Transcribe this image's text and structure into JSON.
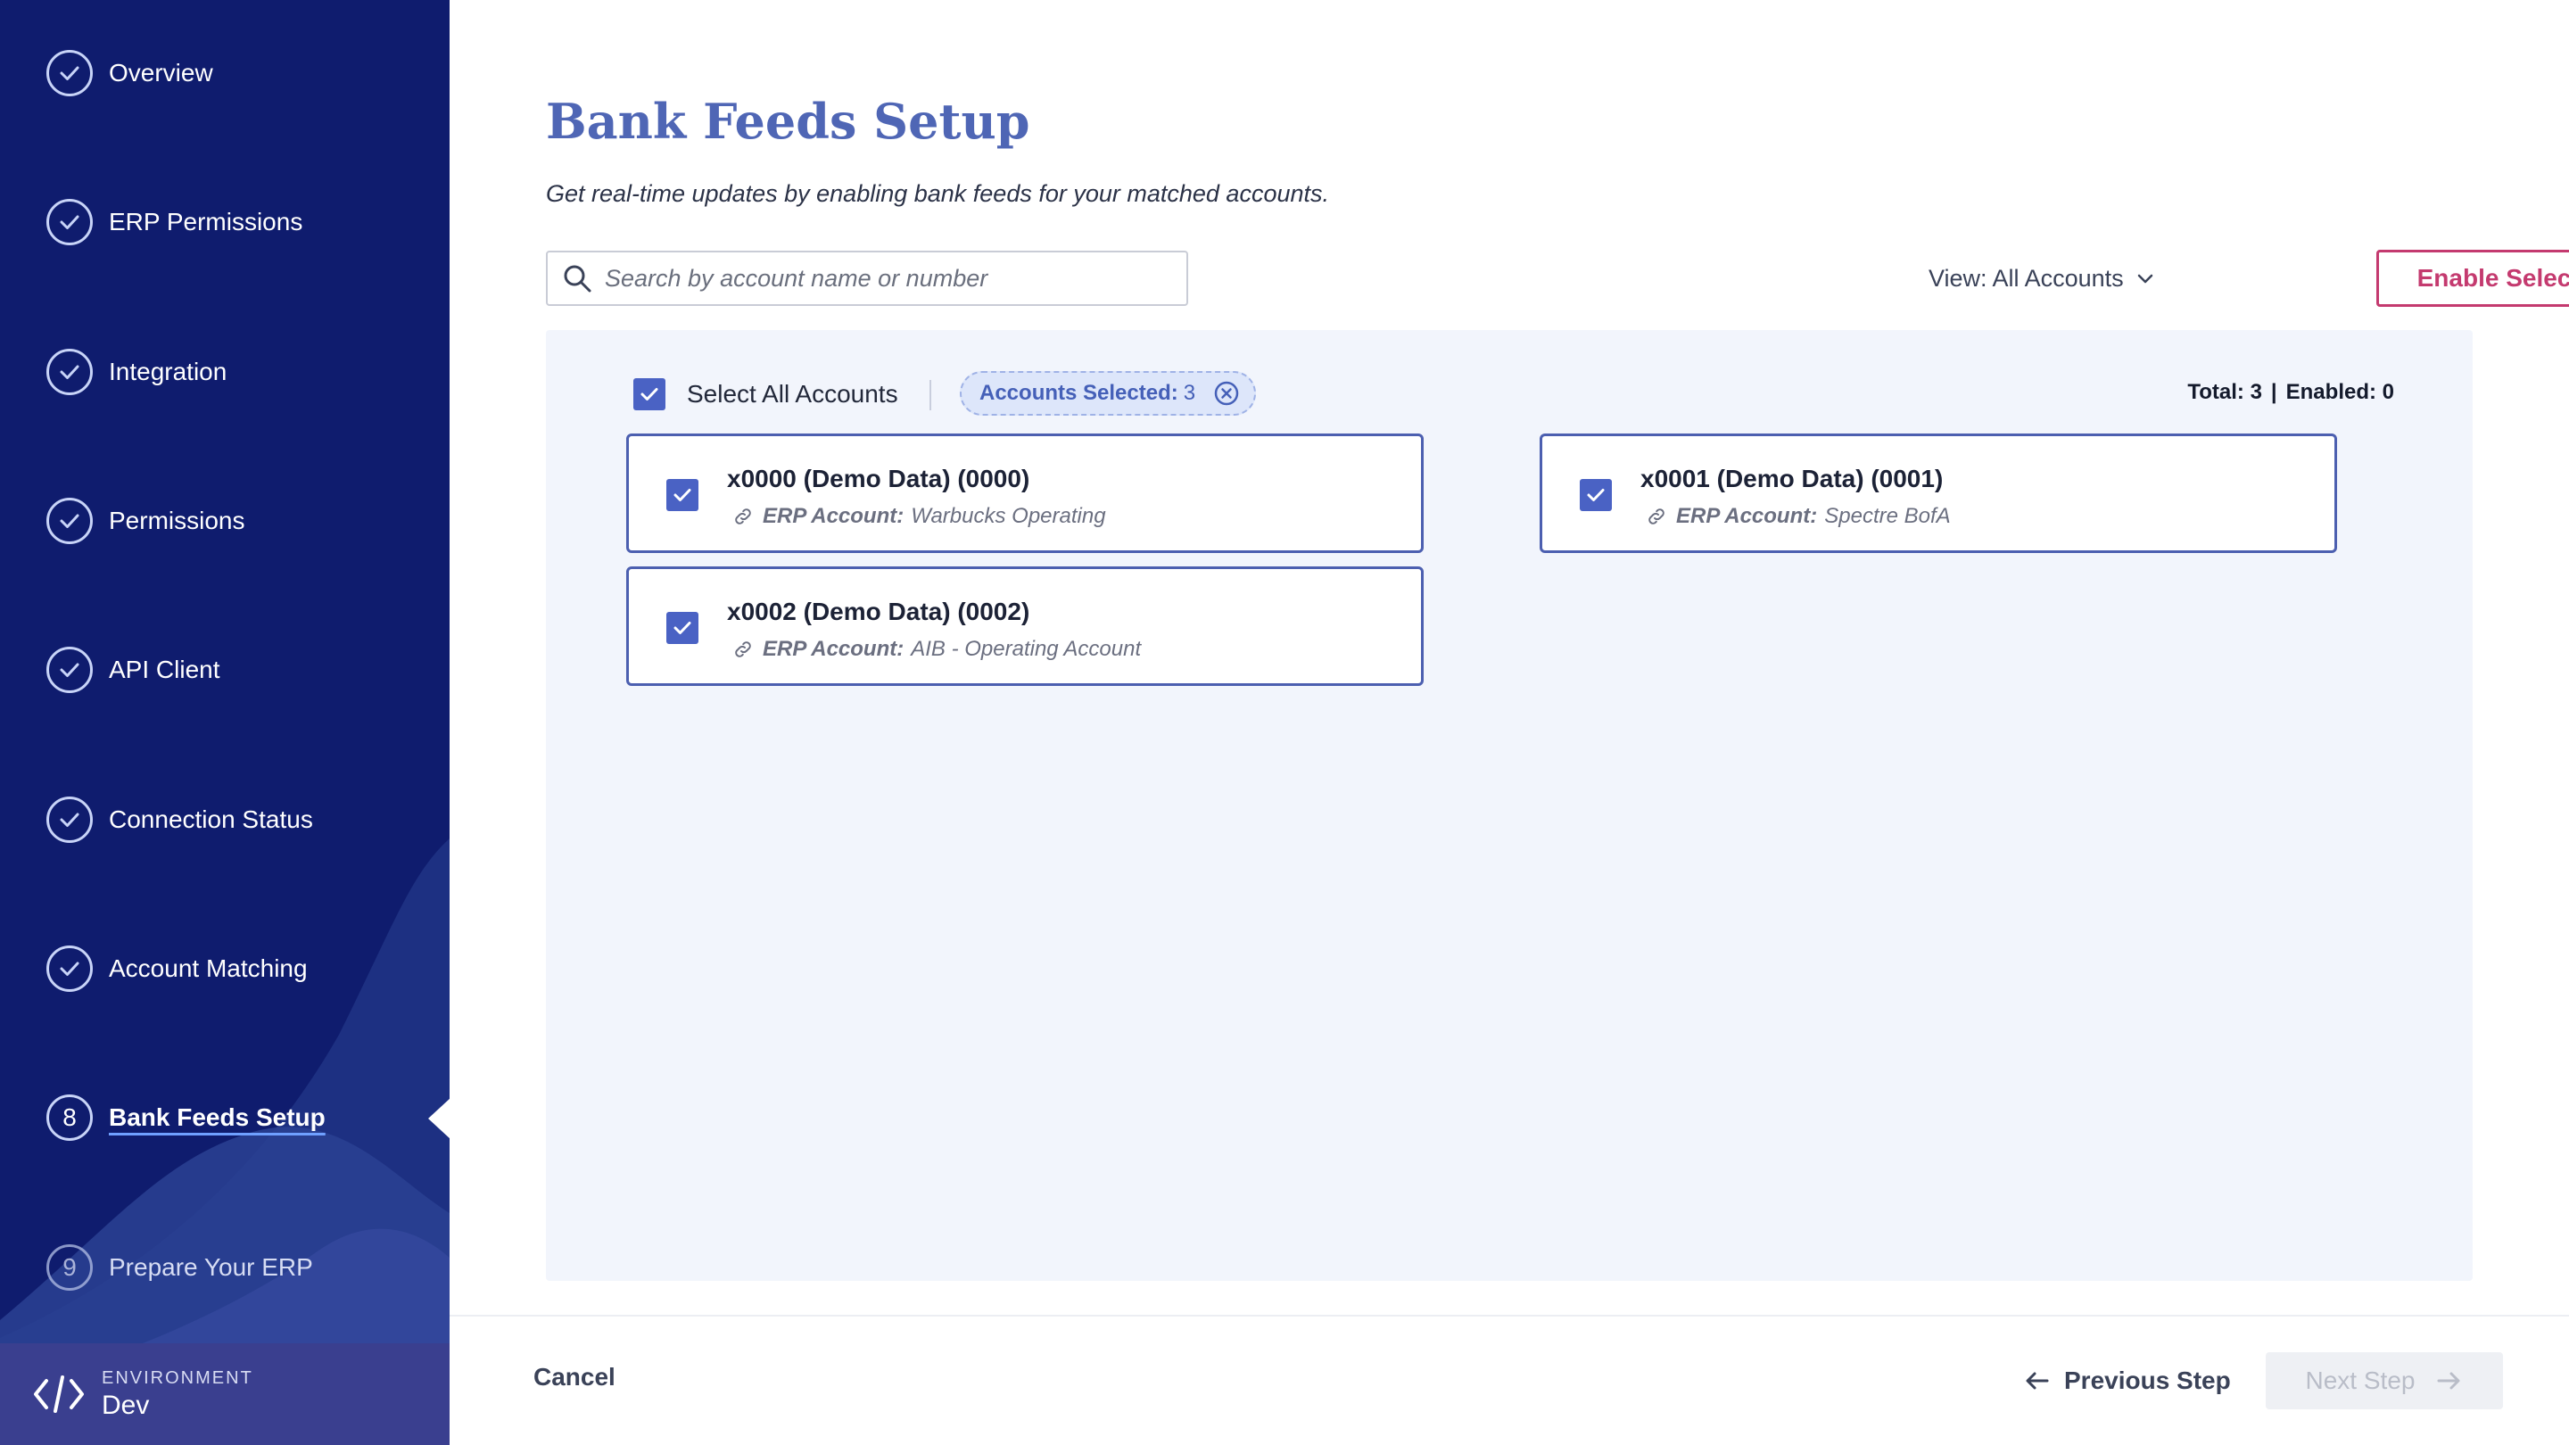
{
  "sidebar": {
    "items": [
      {
        "label": "Overview",
        "state": "done"
      },
      {
        "label": "ERP Permissions",
        "state": "done"
      },
      {
        "label": "Integration",
        "state": "done"
      },
      {
        "label": "Permissions",
        "state": "done"
      },
      {
        "label": "API Client",
        "state": "done"
      },
      {
        "label": "Connection Status",
        "state": "done"
      },
      {
        "label": "Account Matching",
        "state": "done"
      },
      {
        "label": "Bank Feeds Setup",
        "state": "active",
        "number": "8"
      },
      {
        "label": "Prepare Your ERP",
        "state": "upcoming",
        "number": "9"
      }
    ],
    "environment": {
      "caption": "ENVIRONMENT",
      "value": "Dev"
    }
  },
  "page": {
    "title": "Bank Feeds Setup",
    "subtitle": "Get real-time updates by enabling bank feeds for your matched accounts."
  },
  "toolbar": {
    "search_placeholder": "Search by account name or number",
    "view_label": "View: All Accounts",
    "enable_label": "Enable Selected"
  },
  "selection": {
    "select_all_label": "Select All Accounts",
    "chip_label": "Accounts Selected:",
    "chip_count": "3",
    "total_text": "Total: 3",
    "enabled_text": "Enabled: 0"
  },
  "accounts": [
    {
      "name": "x0000 (Demo Data) (0000)",
      "erp_key": "ERP Account:",
      "erp_value": "Warbucks Operating",
      "checked": true
    },
    {
      "name": "x0001 (Demo Data) (0001)",
      "erp_key": "ERP Account:",
      "erp_value": "Spectre BofA",
      "checked": true
    },
    {
      "name": "x0002 (Demo Data) (0002)",
      "erp_key": "ERP Account:",
      "erp_value": "AIB - Operating Account",
      "checked": true
    }
  ],
  "footer": {
    "cancel_label": "Cancel",
    "previous_label": "Previous Step",
    "next_label": "Next Step"
  },
  "colors": {
    "sidebar_bg": "#0f1c6e",
    "title": "#4f66b5",
    "accent_pink": "#c43a6f",
    "checkbox": "#4a62c4"
  }
}
